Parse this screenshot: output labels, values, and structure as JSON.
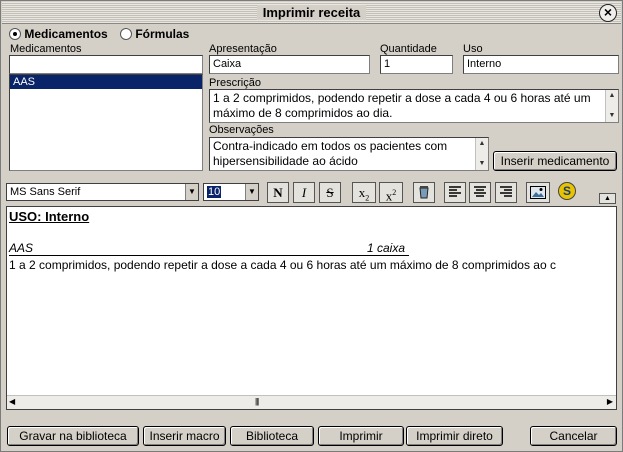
{
  "window": {
    "title": "Imprimir receita"
  },
  "mode": {
    "option1": "Medicamentos",
    "option2": "Fórmulas",
    "selected": "Medicamentos"
  },
  "left": {
    "label": "Medicamentos",
    "search_value": "",
    "list": [
      "AAS"
    ]
  },
  "form": {
    "apresentacao_label": "Apresentação",
    "apresentacao_value": "Caixa",
    "quantidade_label": "Quantidade",
    "quantidade_value": "1",
    "uso_label": "Uso",
    "uso_value": "Interno",
    "prescricao_label": "Prescrição",
    "prescricao_value": "1 a 2 comprimidos, podendo repetir a dose a cada 4 ou 6 horas até um máximo de 8 comprimidos ao dia.",
    "observacoes_label": "Observações",
    "observacoes_value": "Contra-indicado em todos os pacientes com hipersensibilidade ao ácido",
    "insert_button": "Inserir medicamento"
  },
  "toolbar": {
    "font": "MS Sans Serif",
    "size": "10",
    "bold": "N",
    "italic": "I",
    "strike": "S",
    "subscript": "x",
    "sub_mark": "2",
    "superscript": "x",
    "sup_mark": "2",
    "icons": [
      "bucket-icon",
      "align-left-icon",
      "align-center-icon",
      "align-right-icon",
      "image-icon",
      "spell-check-icon",
      "collapse-icon"
    ]
  },
  "editor": {
    "heading": "USO: Interno",
    "drug": "AAS",
    "qty": "1 caixa",
    "line": "1 a 2 comprimidos, podendo repetir a dose a cada 4 ou 6 horas até um máximo de 8 comprimidos ao c"
  },
  "bottom": {
    "gravar": "Gravar na biblioteca",
    "macro": "Inserir macro",
    "biblioteca": "Biblioteca",
    "imprimir": "Imprimir",
    "imprimir_direto": "Imprimir direto",
    "cancelar": "Cancelar"
  }
}
